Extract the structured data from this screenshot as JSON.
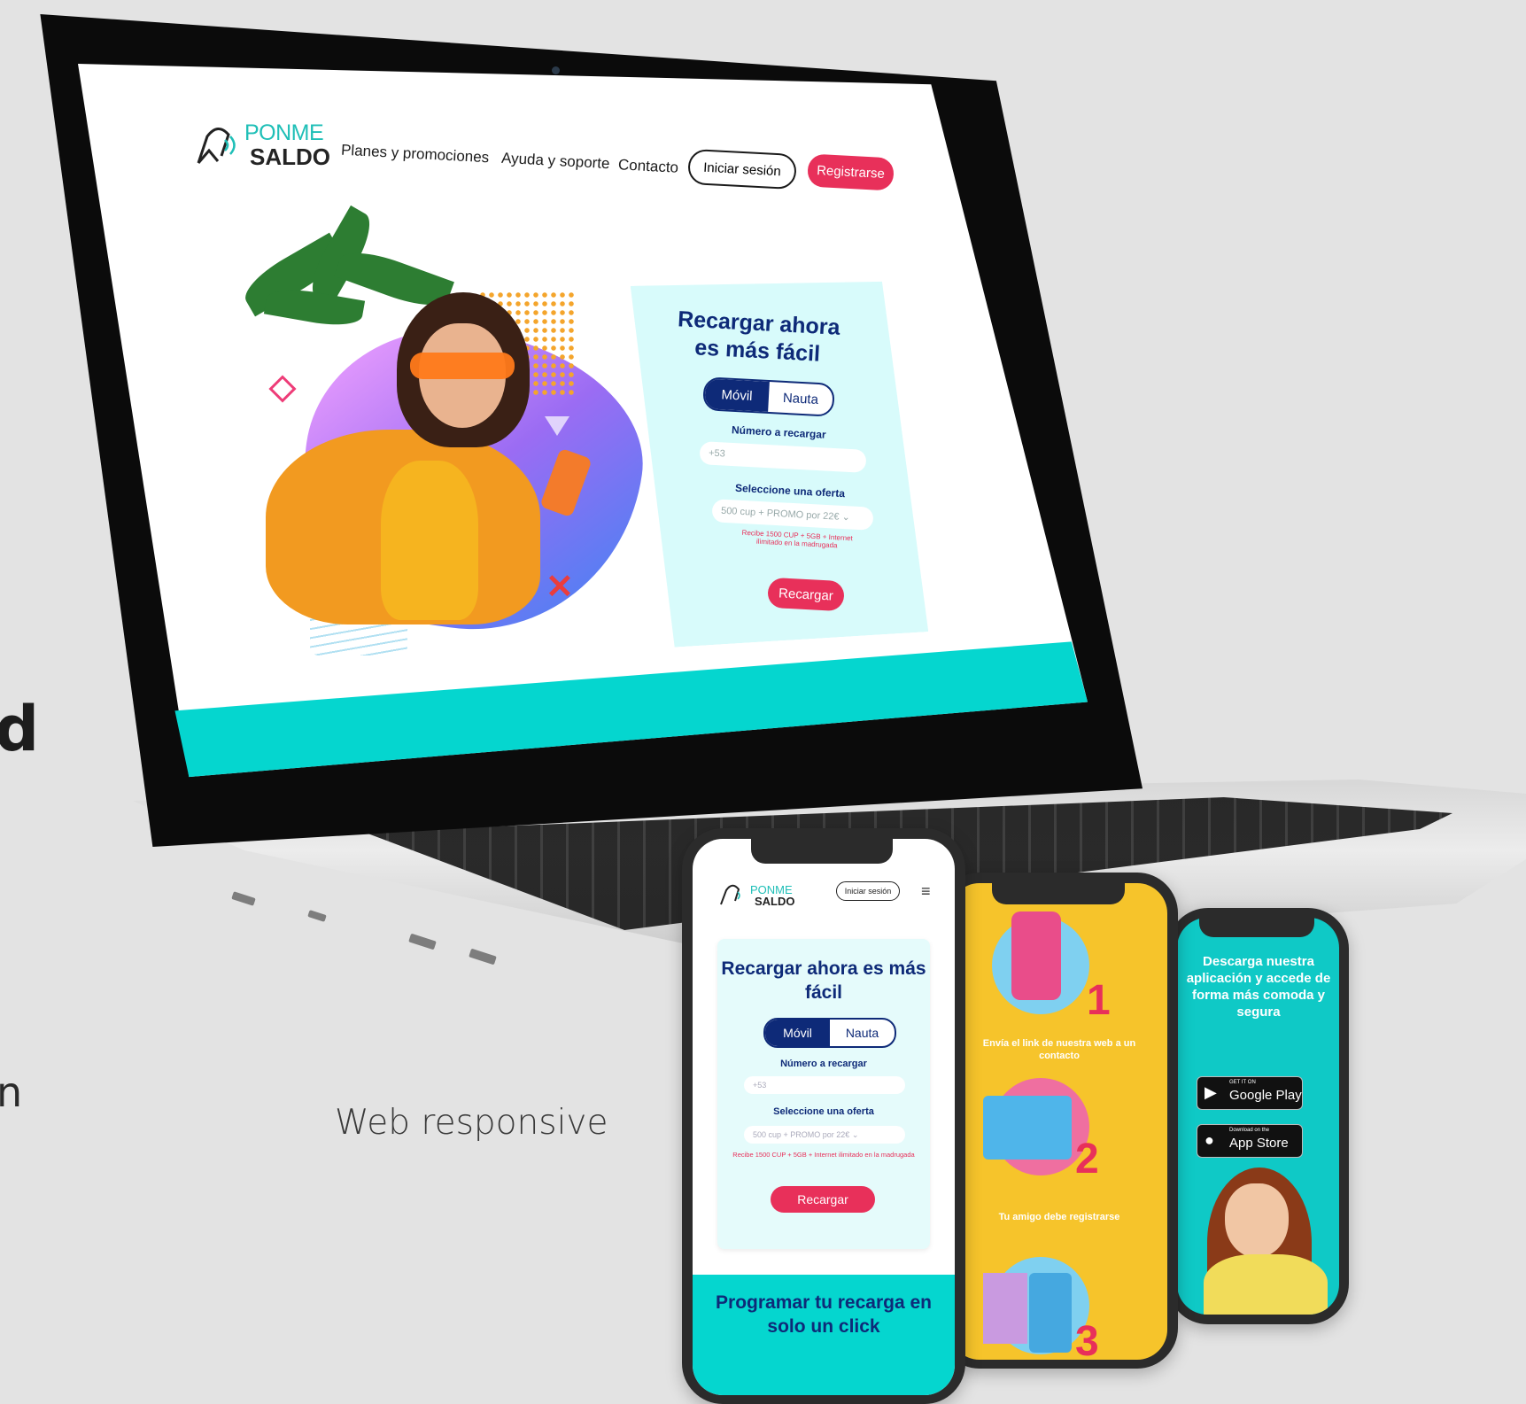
{
  "laptop": {
    "logo": {
      "line1": "PONME",
      "line2": "SALDO"
    },
    "nav": {
      "plans": "Planes y promociones",
      "help": "Ayuda y soporte",
      "contact": "Contacto",
      "login": "Iniciar sesión",
      "register": "Registrarse"
    },
    "card": {
      "title": "Recargar ahora es más fácil",
      "tab_mobile": "Móvil",
      "tab_nauta": "Nauta",
      "number_label": "Número a recargar",
      "number_placeholder": "+53",
      "offer_label": "Seleccione una oferta",
      "offer_value": "500 cup + PROMO por 22€",
      "offer_note": "Recibe 1500 CUP + 5GB + Internet ilimitado en la madrugada",
      "submit": "Recargar"
    }
  },
  "caption": "Web responsive",
  "edge_text": {
    "top": "d",
    "bottom": "n"
  },
  "phone1": {
    "logo": {
      "line1": "PONME",
      "line2": "SALDO"
    },
    "login": "Iniciar sesión",
    "menu_icon": "hamburger-icon",
    "card": {
      "title": "Recargar ahora es más fácil",
      "tab_mobile": "Móvil",
      "tab_nauta": "Nauta",
      "number_label": "Número a recargar",
      "number_placeholder": "+53",
      "offer_label": "Seleccione una oferta",
      "offer_value": "500 cup + PROMO por 22€",
      "offer_note": "Recibe 1500 CUP + 5GB + Internet ilimitado en la madrugada",
      "submit": "Recargar"
    },
    "banner": "Programar tu recarga en solo un click"
  },
  "phone2": {
    "step1": {
      "number": "1",
      "text": "Envía el link de nuestra web a un contacto"
    },
    "step2": {
      "number": "2",
      "text": "Tu amigo debe registrarse"
    },
    "step3": {
      "number": "3"
    }
  },
  "phone3": {
    "title": "Descarga nuestra aplicación y accede de forma más comoda y segura",
    "google_play": {
      "small": "GET IT ON",
      "big": "Google Play"
    },
    "app_store": {
      "small": "Download on the",
      "big": "App Store"
    }
  },
  "colors": {
    "brand_teal": "#05d6cf",
    "brand_navy": "#0e2a78",
    "brand_pink": "#e8305a",
    "yellow": "#f6c42b"
  }
}
